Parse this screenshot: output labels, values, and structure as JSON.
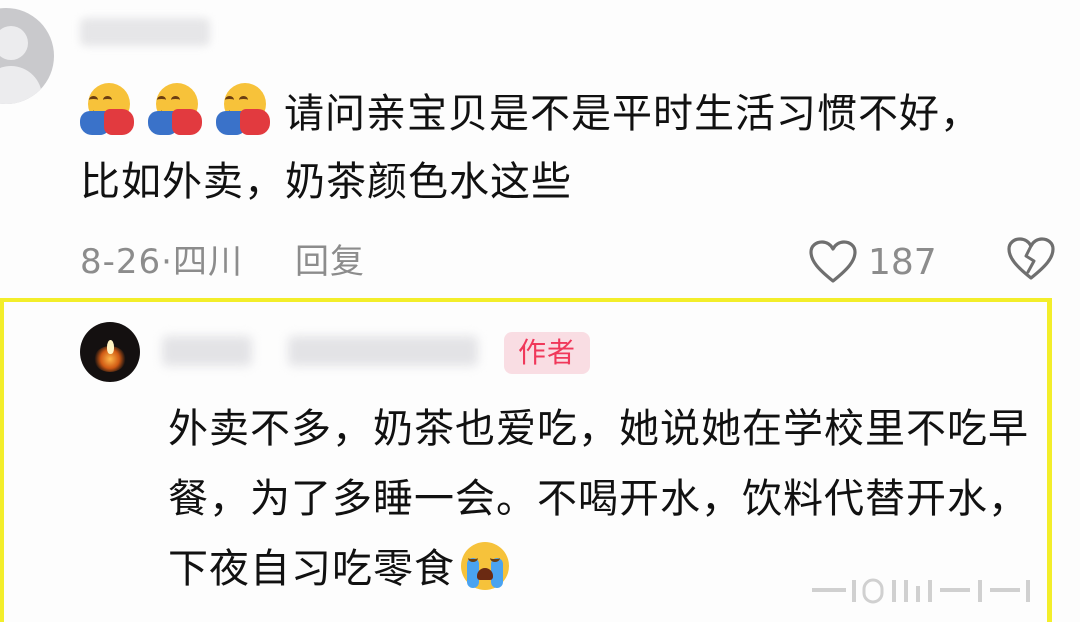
{
  "comment": {
    "author_name": "",
    "text": "请问亲宝贝是不是平时生活习惯不好，比如外卖，奶茶颜色水这些",
    "date": "8-26",
    "separator": "·",
    "location": "四川",
    "reply_label": "回复",
    "like_count": "187",
    "emojis": [
      "hugging-face-emoji",
      "hugging-face-emoji",
      "hugging-face-emoji"
    ]
  },
  "author_reply": {
    "author_name": "",
    "badge": "作者",
    "text": "外卖不多，奶茶也爱吃，她说她在学校里不吃早餐，为了多睡一会。不喝开水，饮料代替开水，下夜自习吃零食",
    "emoji": "loudly-crying-face-emoji"
  },
  "colors": {
    "highlight_border": "#f3ee2a",
    "badge_text": "#f0385a",
    "badge_bg": "#f9dde3",
    "meta_text": "#8c8c8c"
  }
}
